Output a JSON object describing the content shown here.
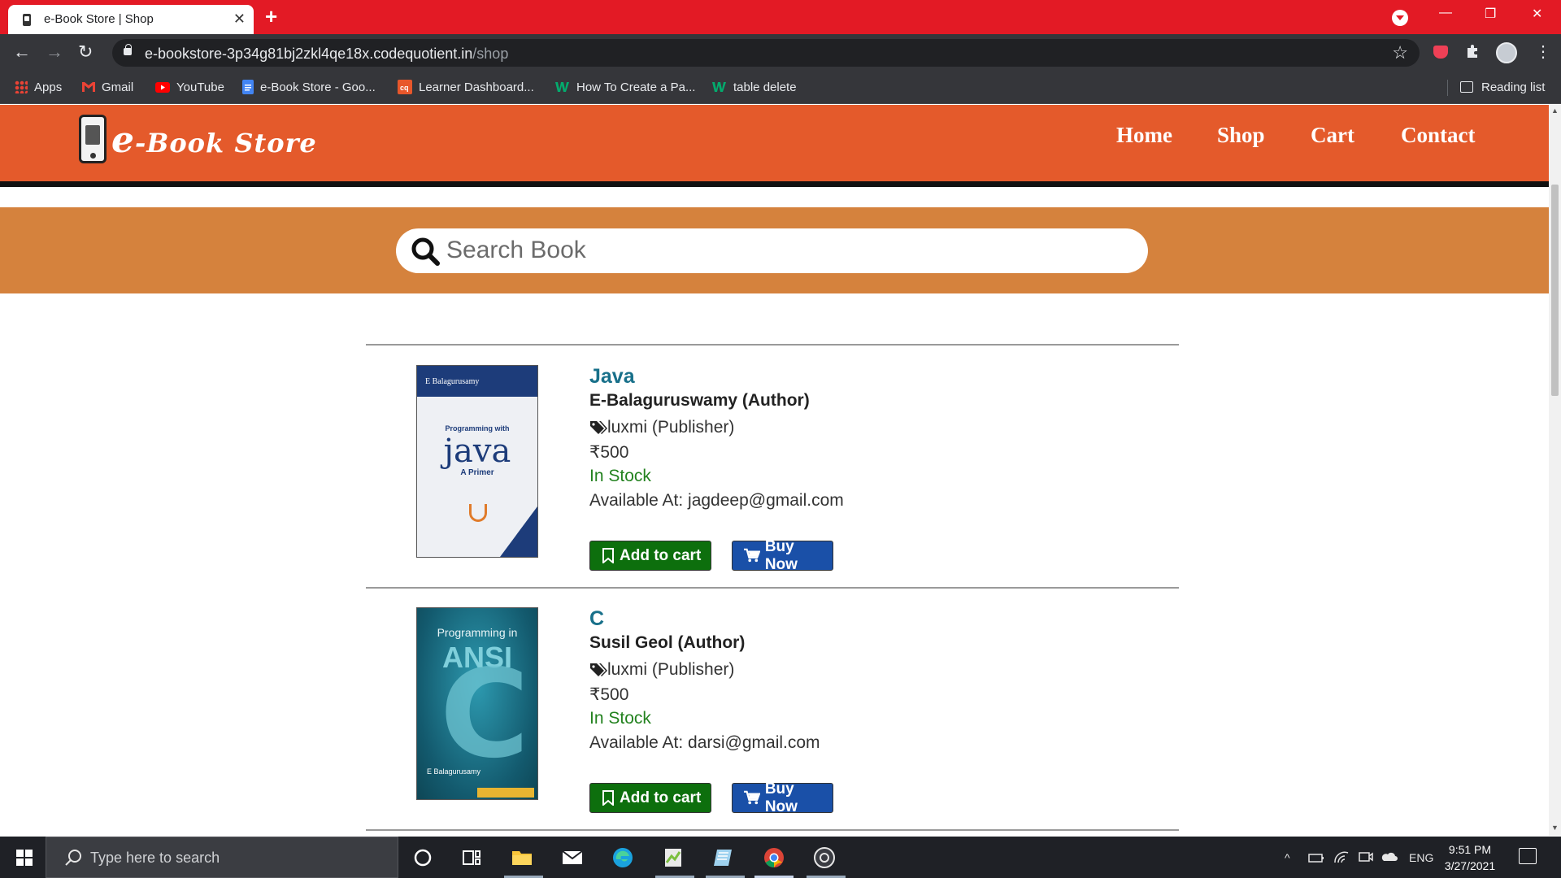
{
  "browser": {
    "tab_title": "e-Book Store | Shop",
    "tab_close": "✕",
    "new_tab": "+",
    "url_host": "e-bookstore-3p34g81bj2zkl4qe18x.codequotient.in",
    "url_path": "/shop",
    "window_controls": {
      "minimize": "—",
      "restore": "❐",
      "close": "✕"
    },
    "nav": {
      "back": "←",
      "forward": "→",
      "reload": "↻"
    },
    "star": "☆",
    "menu": "⋮",
    "bookmarks": [
      {
        "label": "Apps",
        "icon": "apps-grid-icon",
        "color": "#ea4335"
      },
      {
        "label": "Gmail",
        "icon": "gmail-icon",
        "color": "#ea4335"
      },
      {
        "label": "YouTube",
        "icon": "youtube-icon",
        "color": "#ff0000"
      },
      {
        "label": "e-Book Store - Goo...",
        "icon": "google-docs-icon",
        "color": "#4285f4"
      },
      {
        "label": "Learner Dashboard...",
        "icon": "codequotient-icon",
        "color": "#e8572b"
      },
      {
        "label": "How To Create a Pa...",
        "icon": "w3schools-icon",
        "color": "#04aa6d"
      },
      {
        "label": "table delete",
        "icon": "w3schools-icon",
        "color": "#04aa6d"
      }
    ],
    "reading_list": "Reading list"
  },
  "site": {
    "logo_initial": "e",
    "logo_text": "-Book Store",
    "nav": [
      "Home",
      "Shop",
      "Cart",
      "Contact"
    ],
    "search_placeholder": "Search Book",
    "colors": {
      "header": "#e45a2b",
      "search_band": "#d5823d",
      "title": "#18708a",
      "in_stock": "#23821f",
      "cart_btn": "#0d6f0d",
      "buy_btn": "#1a50a8"
    }
  },
  "books": [
    {
      "title": "Java",
      "author": "E-Balaguruswamy (Author)",
      "publisher": "luxmi (Publisher)",
      "price": "₹500",
      "stock": "In Stock",
      "available": "Available At: jagdeep@gmail.com",
      "cover": {
        "author": "E Balagurusamy",
        "sub": "Programming with",
        "big": "java",
        "primer": "A Primer"
      }
    },
    {
      "title": "C",
      "author": "Susil Geol (Author)",
      "publisher": "luxmi (Publisher)",
      "price": "₹500",
      "stock": "In Stock",
      "available": "Available At: darsi@gmail.com",
      "cover": {
        "title": "Programming in",
        "ansi": "ANSI",
        "big": "C",
        "author": "E Balagurusamy"
      }
    }
  ],
  "buttons": {
    "add_to_cart": "Add to cart",
    "buy_now": "Buy Now"
  },
  "taskbar": {
    "search_placeholder": "Type here to search",
    "language": "ENG",
    "time": "9:51 PM",
    "date": "3/27/2021"
  }
}
